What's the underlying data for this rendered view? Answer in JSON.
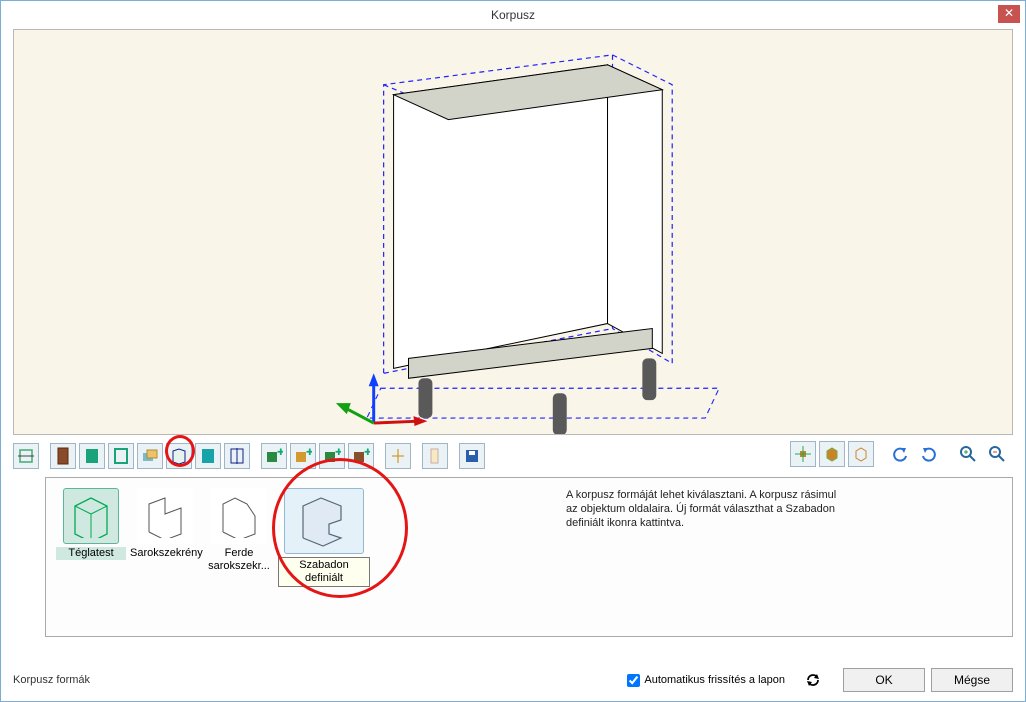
{
  "window": {
    "title": "Korpusz"
  },
  "gallery": {
    "items": [
      {
        "label": "Téglatest"
      },
      {
        "label": "Sarokszekrény"
      },
      {
        "label": "Ferde sarokszekr..."
      },
      {
        "label": "Szabadon definiált"
      }
    ],
    "help": "A korpusz formáját lehet kiválasztani. A korpusz rásimul az objektum oldalaira. Új formát választhat a Szabadon definiált ikonra kattintva."
  },
  "status": {
    "section_label": "Korpusz formák",
    "auto_update_label": "Automatikus frissítés a lapon",
    "auto_update_checked": true
  },
  "buttons": {
    "ok": "OK",
    "cancel": "Mégse"
  }
}
